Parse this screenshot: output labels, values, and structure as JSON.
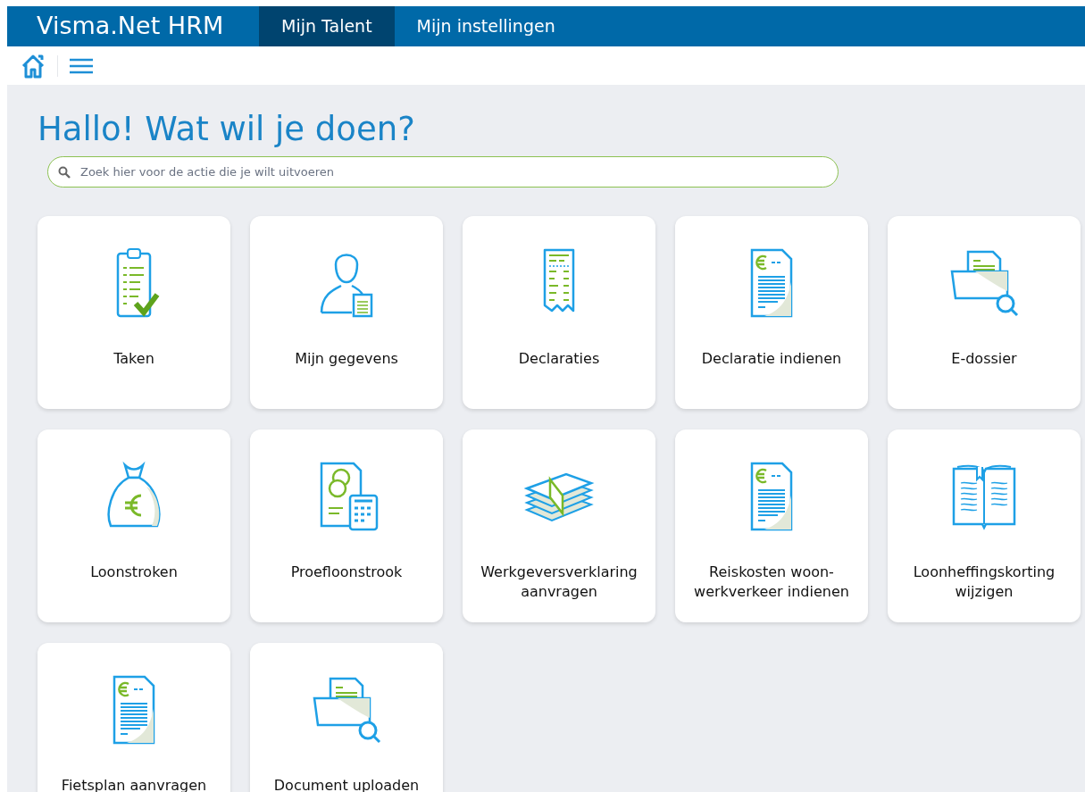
{
  "header": {
    "brand": "Visma.Net HRM",
    "tabs": [
      {
        "label": "Mijn Talent",
        "selected": true
      },
      {
        "label": "Mijn instellingen",
        "selected": false
      }
    ]
  },
  "heading": "Hallo! Wat wil je doen?",
  "search": {
    "placeholder": "Zoek hier voor de actie die je wilt uitvoeren"
  },
  "tiles": [
    {
      "kind": "clipboard",
      "label": "Taken"
    },
    {
      "kind": "person",
      "label": "Mijn gegevens"
    },
    {
      "kind": "receipt",
      "label": "Declaraties"
    },
    {
      "kind": "euro-document",
      "label": "Declaratie indienen"
    },
    {
      "kind": "folder",
      "label": "E-dossier"
    },
    {
      "kind": "moneybag",
      "label": "Loonstroken"
    },
    {
      "kind": "calculator",
      "label": "Proefloonstrook"
    },
    {
      "kind": "banknotes",
      "label": "Werkgeversverklaring aanvragen"
    },
    {
      "kind": "euro-document",
      "label": "Reiskosten woon-werkverkeer indienen"
    },
    {
      "kind": "book",
      "label": "Loonheffingskorting wijzigen"
    },
    {
      "kind": "euro-document",
      "label": "Fietsplan aanvragen"
    },
    {
      "kind": "folder",
      "label": "Document uploaden"
    }
  ]
}
